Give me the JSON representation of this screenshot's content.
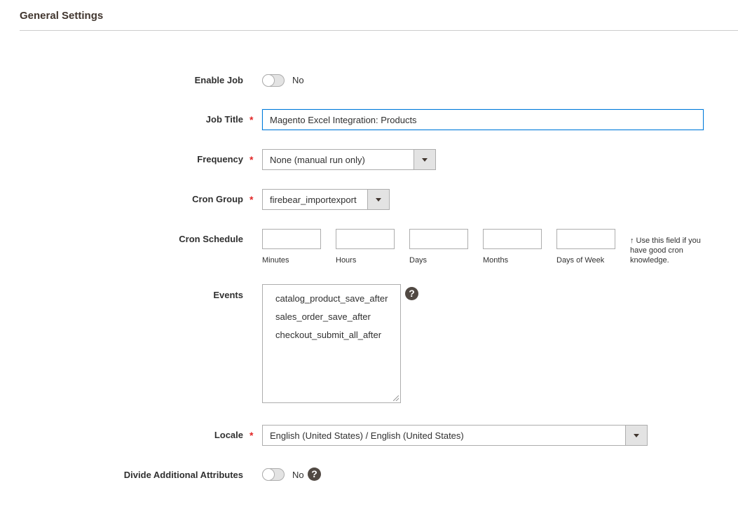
{
  "section": {
    "title": "General Settings"
  },
  "enable_job": {
    "label": "Enable Job",
    "state": "No"
  },
  "job_title": {
    "label": "Job Title",
    "required": "*",
    "value": "Magento Excel Integration: Products"
  },
  "frequency": {
    "label": "Frequency",
    "required": "*",
    "selected": "None (manual run only)"
  },
  "cron_group": {
    "label": "Cron Group",
    "required": "*",
    "selected": "firebear_importexport"
  },
  "cron_schedule": {
    "label": "Cron Schedule",
    "fields": [
      "Minutes",
      "Hours",
      "Days",
      "Months",
      "Days of Week"
    ],
    "note": "↑ Use this field if you have good cron knowledge."
  },
  "events": {
    "label": "Events",
    "options": [
      "catalog_product_save_after",
      "sales_order_save_after",
      "checkout_submit_all_after"
    ],
    "help_icon": "?"
  },
  "locale": {
    "label": "Locale",
    "required": "*",
    "selected": "English (United States) / English (United States)"
  },
  "divide_attributes": {
    "label": "Divide Additional Attributes",
    "state": "No",
    "help_icon": "?"
  },
  "colors": {
    "focus": "#007bdb",
    "required": "#e22626",
    "help_bg": "#514943"
  }
}
